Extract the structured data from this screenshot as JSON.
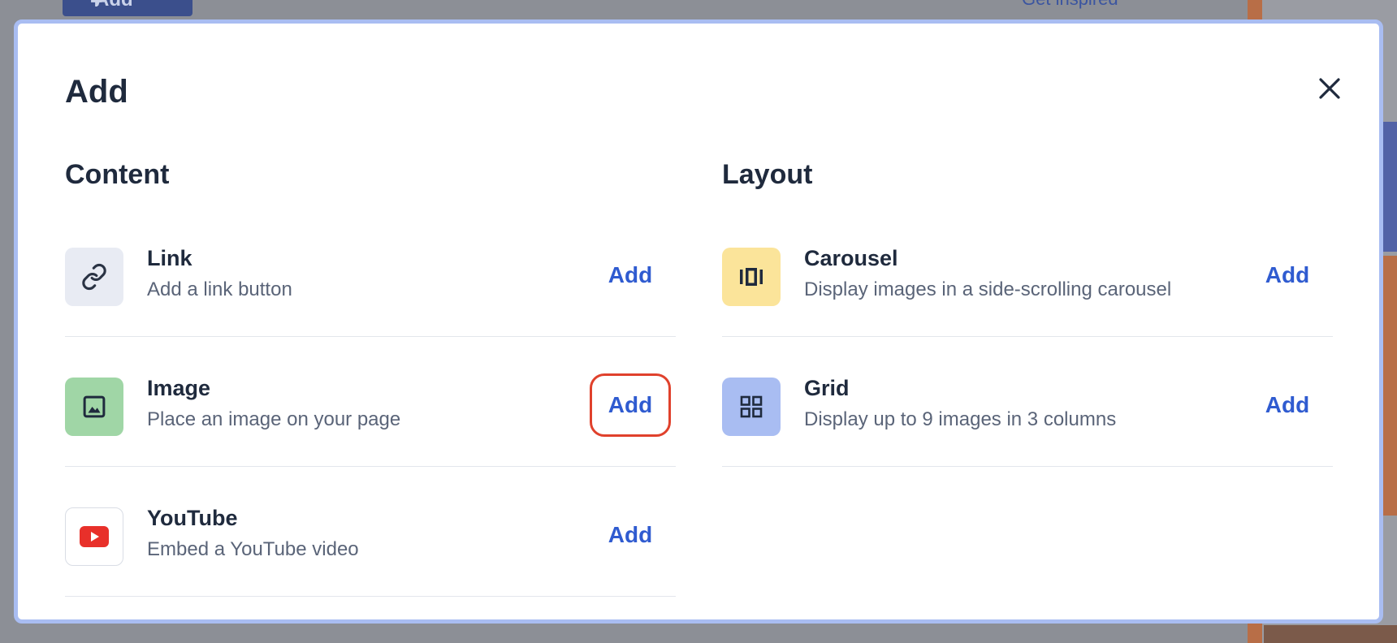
{
  "background": {
    "add_button_label": "Add",
    "get_inspired_label": "Get inspired"
  },
  "modal": {
    "title": "Add",
    "close_label": "Close",
    "content_section": {
      "title": "Content",
      "items": [
        {
          "name": "Link",
          "description": "Add a link button",
          "add_label": "Add",
          "icon": "link-icon",
          "icon_bg": "#e8ebf3"
        },
        {
          "name": "Image",
          "description": "Place an image on your page",
          "add_label": "Add",
          "icon": "image-icon",
          "icon_bg": "#a0d6a6"
        },
        {
          "name": "YouTube",
          "description": "Embed a YouTube video",
          "add_label": "Add",
          "icon": "youtube-icon",
          "icon_bg": "#ffffff"
        }
      ]
    },
    "layout_section": {
      "title": "Layout",
      "items": [
        {
          "name": "Carousel",
          "description": "Display images in a side-scrolling carousel",
          "add_label": "Add",
          "icon": "carousel-icon",
          "icon_bg": "#fbe49a"
        },
        {
          "name": "Grid",
          "description": "Display up to 9 images in 3 columns",
          "add_label": "Add",
          "icon": "grid-icon",
          "icon_bg": "#a9bdf2"
        }
      ]
    }
  },
  "colors": {
    "accent": "#2f5bd0",
    "focus_ring": "#e0412c",
    "modal_border": "#a9bdf2",
    "youtube_red": "#e8302a"
  }
}
